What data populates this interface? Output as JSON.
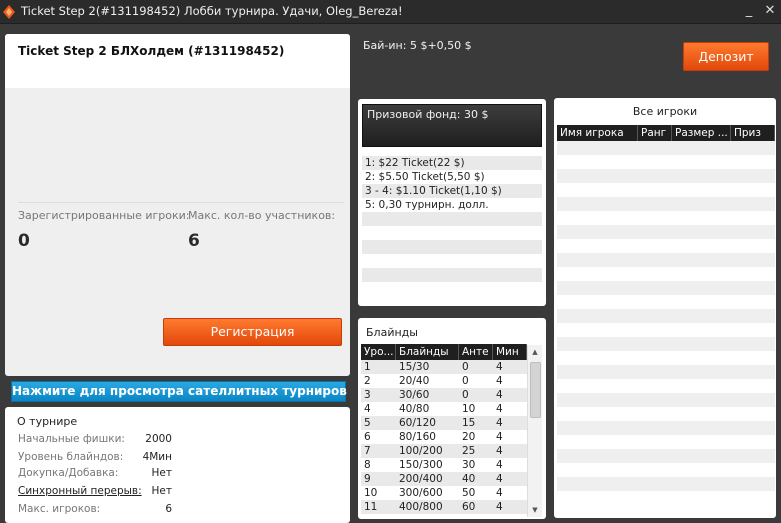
{
  "window": {
    "title": "Ticket Step 2(#131198452) Лобби турнира. Удачи, Oleg_Bereza!",
    "minimize_glyph": "_",
    "close_glyph": "✕"
  },
  "tournament": {
    "name": "Ticket Step 2 БЛХолдем (#131198452)",
    "registered_label": "Зарегистрированные игроки:",
    "max_label": "Макс. кол-во участников:",
    "registered_value": "0",
    "max_value": "6",
    "register_button": "Регистрация"
  },
  "satellite_button": "Нажмите для просмотра сателлитных турниров",
  "about": {
    "header": "О турнире",
    "rows": [
      {
        "label": "Начальные фишки:",
        "value": "2000"
      },
      {
        "label": "Уровень блайндов:",
        "value": "4Мин"
      },
      {
        "label": "Докупка/Добавка:",
        "value": "Нет"
      },
      {
        "label": "Синхронный перерыв:",
        "value": "Нет"
      },
      {
        "label": "Макс. игроков:",
        "value": "6"
      }
    ]
  },
  "buyin": "Бай-ин: 5 $+0,50 $",
  "deposit_button": "Депозит",
  "prize": {
    "pool": "Призовой фонд: 30 $",
    "places": [
      "1: $22 Ticket(22 $)",
      "2: $5.50 Ticket(5,50 $)",
      "3 - 4: $1.10 Ticket(1,10 $)",
      "5: 0,30 турнирн. долл."
    ]
  },
  "blinds": {
    "header": "Блайнды",
    "columns": [
      "Уро...",
      "Блайнды",
      "Анте",
      "Мин"
    ],
    "rows": [
      [
        "1",
        "15/30",
        "0",
        "4"
      ],
      [
        "2",
        "20/40",
        "0",
        "4"
      ],
      [
        "3",
        "30/60",
        "0",
        "4"
      ],
      [
        "4",
        "40/80",
        "10",
        "4"
      ],
      [
        "5",
        "60/120",
        "15",
        "4"
      ],
      [
        "6",
        "80/160",
        "20",
        "4"
      ],
      [
        "7",
        "100/200",
        "25",
        "4"
      ],
      [
        "8",
        "150/300",
        "30",
        "4"
      ],
      [
        "9",
        "200/400",
        "40",
        "4"
      ],
      [
        "10",
        "300/600",
        "50",
        "4"
      ],
      [
        "11",
        "400/800",
        "60",
        "4"
      ]
    ]
  },
  "players": {
    "header": "Все игроки",
    "columns": [
      "Имя игрока",
      "Ранг",
      "Размер ...",
      "Приз"
    ]
  }
}
